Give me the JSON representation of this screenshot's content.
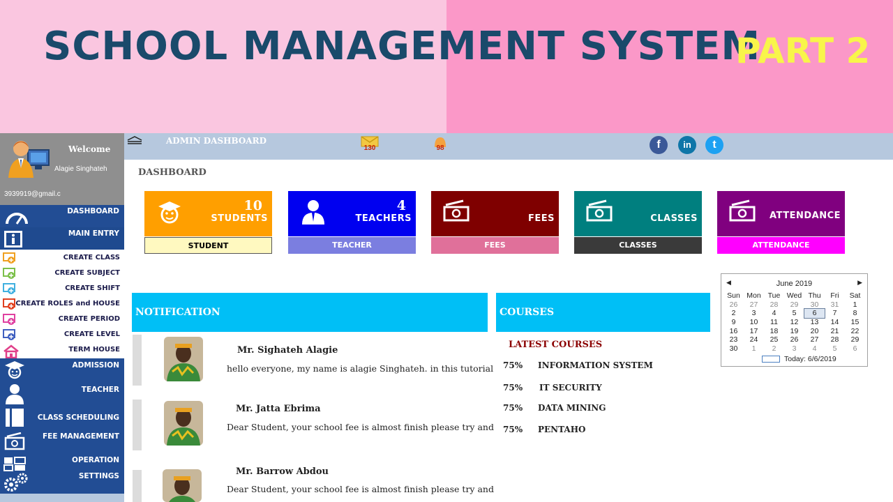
{
  "banner": {
    "title": "SCHOOL MANAGEMENT SYSTEM",
    "part": "PART 2",
    "colors": {
      "left_bg": "#fac6e0",
      "right_bg": "#fb98c8",
      "title": "#1a4a6b",
      "part": "#f8f54a"
    }
  },
  "profile": {
    "welcome": "Welcome",
    "name": "Alagie Singhateh",
    "email": "3939919@gmail.c"
  },
  "sidebar": {
    "items": [
      {
        "label": "DASHBOARD",
        "icon": "speedometer-icon"
      },
      {
        "label": "MAIN ENTRY",
        "icon": "info-book-icon"
      },
      {
        "label": "ADMISSION",
        "icon": "graduate-icon"
      },
      {
        "label": "TEACHER",
        "icon": "person-icon"
      },
      {
        "label": "CLASS SCHEDULING",
        "icon": "book-icon"
      },
      {
        "label": "FEE MANAGEMENT",
        "icon": "money-icon"
      },
      {
        "label": "OPERATION",
        "icon": "grid-icon"
      },
      {
        "label": "SETTINGS",
        "icon": "gears-icon"
      }
    ],
    "subitems": [
      {
        "label": "CREATE CLASS",
        "icon": "add-icon"
      },
      {
        "label": "CREATE SUBJECT",
        "icon": "add-icon"
      },
      {
        "label": "CREATE SHIFT",
        "icon": "add-icon"
      },
      {
        "label": "CREATE ROLES and HOUSE",
        "icon": "add-icon"
      },
      {
        "label": "CREATE PERIOD",
        "icon": "add-icon"
      },
      {
        "label": "CREATE LEVEL",
        "icon": "add-icon"
      },
      {
        "label": "TERM  HOUSE",
        "icon": "house-icon"
      }
    ],
    "colors": {
      "blue": "#224d94",
      "profile_bg": "#8f8f8f"
    }
  },
  "topbar": {
    "title": "ADMIN DASHBOARD",
    "mail_count": "130",
    "bell_count": "98",
    "social": [
      {
        "icon": "facebook-icon",
        "glyph": "f",
        "color": "#3b5998"
      },
      {
        "icon": "linkedin-icon",
        "glyph": "in",
        "color": "#0e76a8"
      },
      {
        "icon": "twitter-icon",
        "glyph": "t",
        "color": "#1da1f2"
      }
    ]
  },
  "main": {
    "section_label": "DASHBOARD",
    "cards": [
      {
        "number": "10",
        "caption": "STUDENTS",
        "footer": "STUDENT",
        "color": "#ff9f00",
        "footer_bg": "#fff9c0",
        "footer_fg": "#000000",
        "icon": "graduate-face-icon"
      },
      {
        "number": "4",
        "caption": "TEACHERS",
        "footer": "TEACHER",
        "color": "#0000f0",
        "footer_bg": "#7b7ee0",
        "footer_fg": "#ffffff",
        "icon": "teacher-icon"
      },
      {
        "number": "",
        "caption": "FEES",
        "footer": "FEES",
        "color": "#7f0000",
        "footer_bg": "#e0709a",
        "footer_fg": "#ffffff",
        "icon": "money-icon"
      },
      {
        "number": "",
        "caption": "CLASSES",
        "footer": "CLASSES",
        "color": "#007f7f",
        "footer_bg": "#3a3a3a",
        "footer_fg": "#ffffff",
        "icon": "money-icon"
      },
      {
        "number": "",
        "caption": "ATTENDANCE",
        "footer": "ATTENDANCE",
        "color": "#80007f",
        "footer_bg": "#ff00ff",
        "footer_fg": "#ffffff",
        "icon": "money-icon"
      }
    ],
    "notification_title": "NOTIFICATION",
    "courses_title": "COURSES",
    "notifications": [
      {
        "name": "Mr. Sighateh Alagie",
        "message": "hello everyone, my name is alagie Singhateh. in this tutorial"
      },
      {
        "name": "Mr. Jatta Ebrima",
        "message": "Dear Student, your school fee is almost finish please try and"
      },
      {
        "name": "Mr. Barrow Abdou",
        "message": "Dear Student, your school fee is almost finish please try and"
      }
    ],
    "latest_courses_label": "LATEST COURSES",
    "courses": [
      {
        "percent": "75%",
        "name": "INFORMATION SYSTEM"
      },
      {
        "percent": "75%",
        "name": "IT SECURITY"
      },
      {
        "percent": "75%",
        "name": "DATA MINING"
      },
      {
        "percent": "75%",
        "name": "PENTAHO"
      }
    ],
    "panel_color": "#00bff6"
  },
  "calendar": {
    "month": "June 2019",
    "days_of_week": [
      "Sun",
      "Mon",
      "Tue",
      "Wed",
      "Thu",
      "Fri",
      "Sat"
    ],
    "weeks": [
      [
        "26",
        "27",
        "28",
        "29",
        "30",
        "31",
        "1"
      ],
      [
        "2",
        "3",
        "4",
        "5",
        "6",
        "7",
        "8"
      ],
      [
        "9",
        "10",
        "11",
        "12",
        "13",
        "14",
        "15"
      ],
      [
        "16",
        "17",
        "18",
        "19",
        "20",
        "21",
        "22"
      ],
      [
        "23",
        "24",
        "25",
        "26",
        "27",
        "28",
        "29"
      ],
      [
        "30",
        "1",
        "2",
        "3",
        "4",
        "5",
        "6"
      ]
    ],
    "selected": "6",
    "today": "Today: 6/6/2019"
  }
}
